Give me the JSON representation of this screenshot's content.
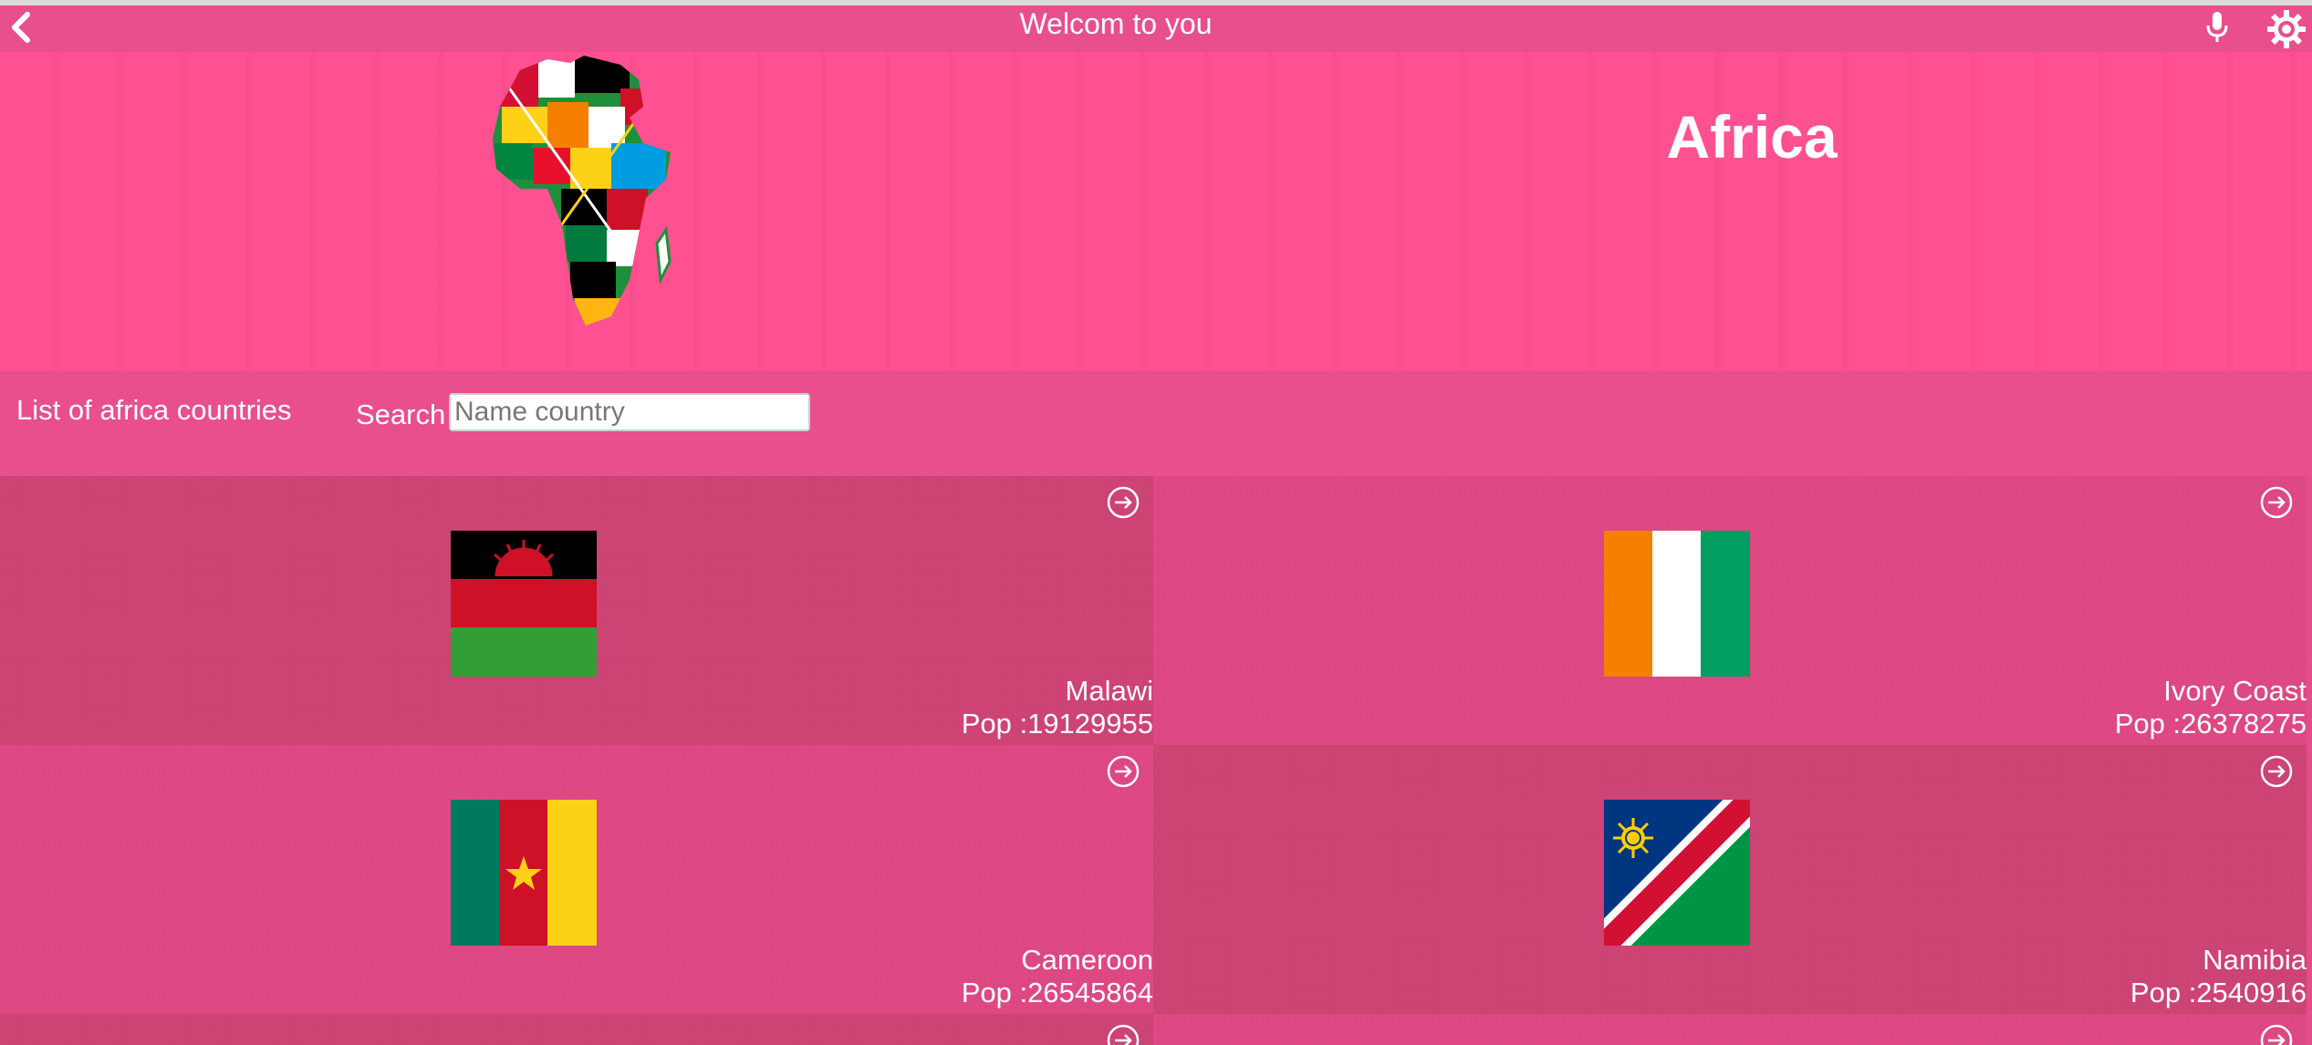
{
  "header": {
    "title": "Welcom to you",
    "back_icon": "chevron-left-icon",
    "mic_icon": "microphone-icon",
    "settings_icon": "gear-icon"
  },
  "banner": {
    "continent": "Africa",
    "map_image": "africa-flags-map"
  },
  "toolbar": {
    "list_label": "List of africa countries",
    "search_label": "Search",
    "search_placeholder": "Name country",
    "search_value": ""
  },
  "countries": [
    {
      "name": "Malawi",
      "population": "Pop :19129955",
      "flag": "malawi-flag"
    },
    {
      "name": "Ivory Coast",
      "population": "Pop :26378275",
      "flag": "ivory-coast-flag"
    },
    {
      "name": "Cameroon",
      "population": "Pop :26545864",
      "flag": "cameroon-flag"
    },
    {
      "name": "Namibia",
      "population": "Pop :2540916",
      "flag": "namibia-flag"
    }
  ],
  "colors": {
    "header_bg": "#e84f8c",
    "banner_bg": "#ff5192",
    "card_dark": "#cd4373",
    "card_light": "#dd4882"
  }
}
